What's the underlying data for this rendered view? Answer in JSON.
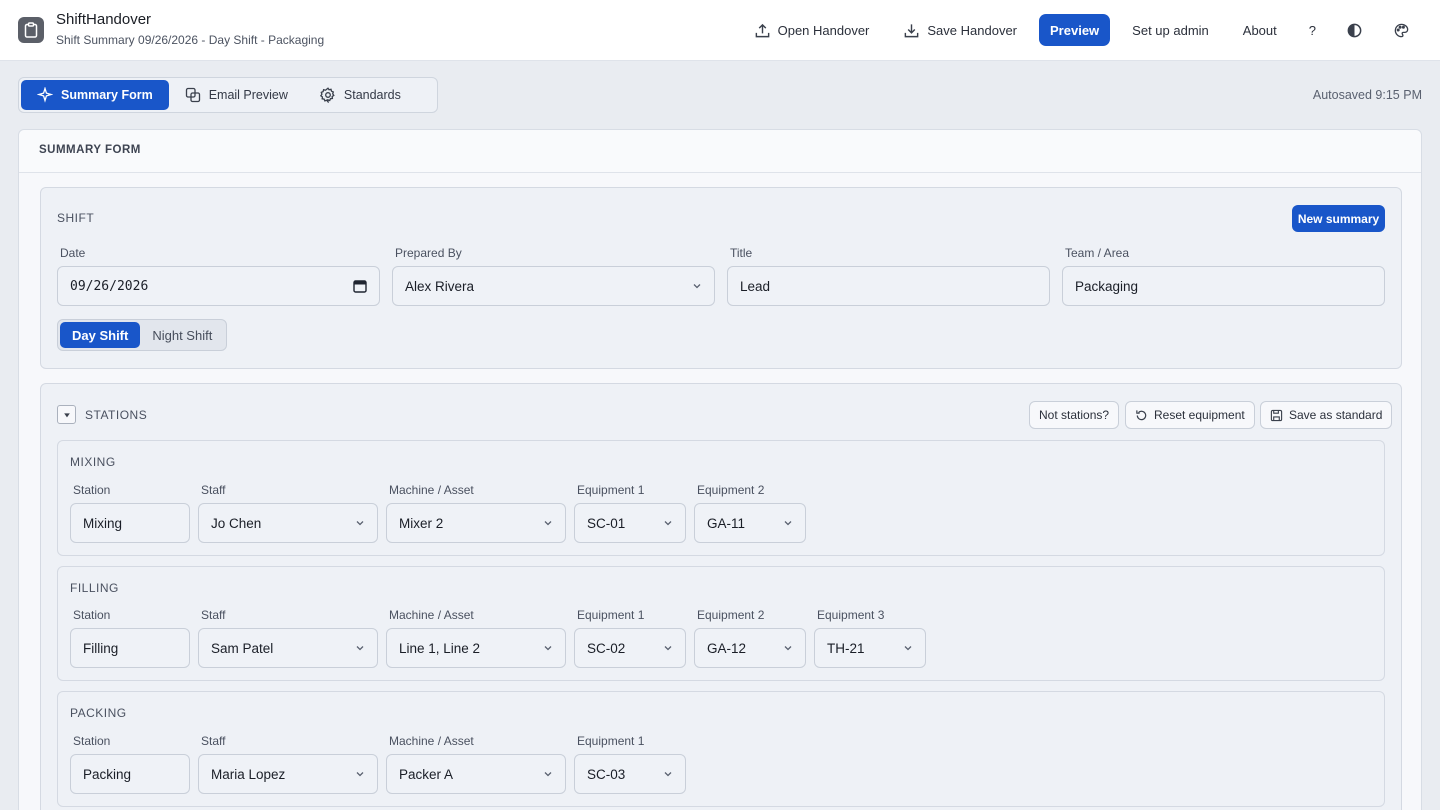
{
  "app": {
    "title": "ShiftHandover",
    "subtitle": "Shift Summary 09/26/2026 - Day Shift - Packaging"
  },
  "toolbar": {
    "open_label": "Open Handover",
    "save_label": "Save Handover",
    "preview_label": "Preview",
    "setup_label": "Set up admin",
    "about_label": "About",
    "help_label": "?"
  },
  "tabs": [
    {
      "label": "Summary Form",
      "icon": "sparkle-icon",
      "active": true
    },
    {
      "label": "Email Preview",
      "icon": "copy-icon",
      "active": false
    },
    {
      "label": "Standards",
      "icon": "gear-icon",
      "active": false
    }
  ],
  "autosaved": "Autosaved 9:15 PM",
  "form": {
    "header": "SUMMARY FORM",
    "shift": {
      "section_label": "SHIFT",
      "new_summary_label": "New summary",
      "date_label": "Date",
      "date_value": "09/26/2026",
      "prepared_by_label": "Prepared By",
      "prepared_by_value": "Alex Rivera",
      "title_label": "Title",
      "title_value": "Lead",
      "team_label": "Team / Area",
      "team_value": "Packaging",
      "shift_options": [
        "Day Shift",
        "Night Shift"
      ],
      "selected_shift": "Day Shift"
    },
    "stations": {
      "section_label": "STATIONS",
      "not_stations_label": "Not stations?",
      "reset_label": "Reset equipment",
      "save_standard_label": "Save as standard",
      "labels": {
        "station": "Station",
        "staff": "Staff",
        "machine": "Machine / Asset",
        "eq1": "Equipment 1",
        "eq2": "Equipment 2",
        "eq3": "Equipment 3"
      },
      "items": [
        {
          "heading": "MIXING",
          "station": "Mixing",
          "staff": "Jo Chen",
          "machine": "Mixer 2",
          "eq1": "SC-01",
          "eq2": "GA-11"
        },
        {
          "heading": "FILLING",
          "station": "Filling",
          "staff": "Sam Patel",
          "machine": "Line 1, Line 2",
          "eq1": "SC-02",
          "eq2": "GA-12",
          "eq3": "TH-21"
        },
        {
          "heading": "PACKING",
          "station": "Packing",
          "staff": "Maria Lopez",
          "machine": "Packer A",
          "eq1": "SC-03"
        }
      ]
    }
  },
  "colors": {
    "accent": "#1956c9",
    "background": "#e9ecf1",
    "panel": "#eef1f6"
  }
}
